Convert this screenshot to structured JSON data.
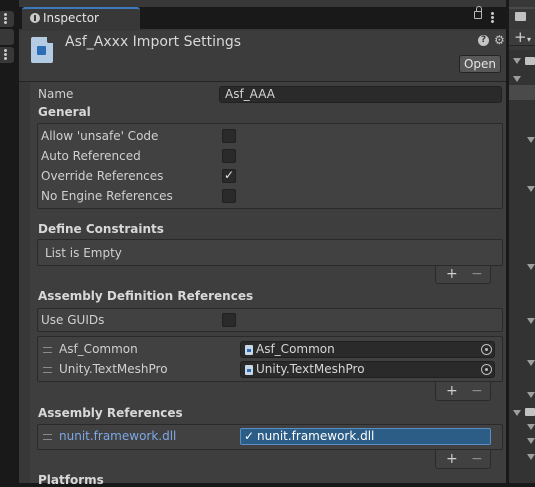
{
  "inspector": {
    "tab_label": "Inspector",
    "header_title": "Asf_Axxx Import Settings",
    "open_button": "Open",
    "name_label": "Name",
    "name_value": "Asf_AAA",
    "general": {
      "title": "General",
      "options": [
        {
          "label": "Allow 'unsafe' Code",
          "checked": false
        },
        {
          "label": "Auto Referenced",
          "checked": false
        },
        {
          "label": "Override References",
          "checked": true
        },
        {
          "label": "No Engine References",
          "checked": false
        }
      ]
    },
    "define_constraints": {
      "title": "Define Constraints",
      "empty_text": "List is Empty"
    },
    "assembly_definition_references": {
      "title": "Assembly Definition References",
      "use_guids_label": "Use GUIDs",
      "use_guids_checked": false,
      "items": [
        {
          "name": "Asf_Common",
          "value": "Asf_Common"
        },
        {
          "name": "Unity.TextMeshPro",
          "value": "Unity.TextMeshPro"
        }
      ]
    },
    "assembly_references": {
      "title": "Assembly References",
      "items": [
        {
          "name": "nunit.framework.dll"
        }
      ],
      "dropdown_selected": "nunit.framework.dll",
      "dropdown_check": "✓"
    },
    "platforms": {
      "title": "Platforms"
    },
    "add_symbol": "+",
    "remove_symbol": "−"
  },
  "colors": {
    "accent": "#3a79bb",
    "panel": "#383838",
    "selection": "#2c5d87"
  },
  "icons": [
    "info-icon",
    "lock-icon",
    "kebab-menu-icon",
    "help-icon",
    "gear-icon",
    "assembly-asset-icon",
    "object-picker-icon",
    "drag-handle-icon",
    "folder-icon"
  ]
}
